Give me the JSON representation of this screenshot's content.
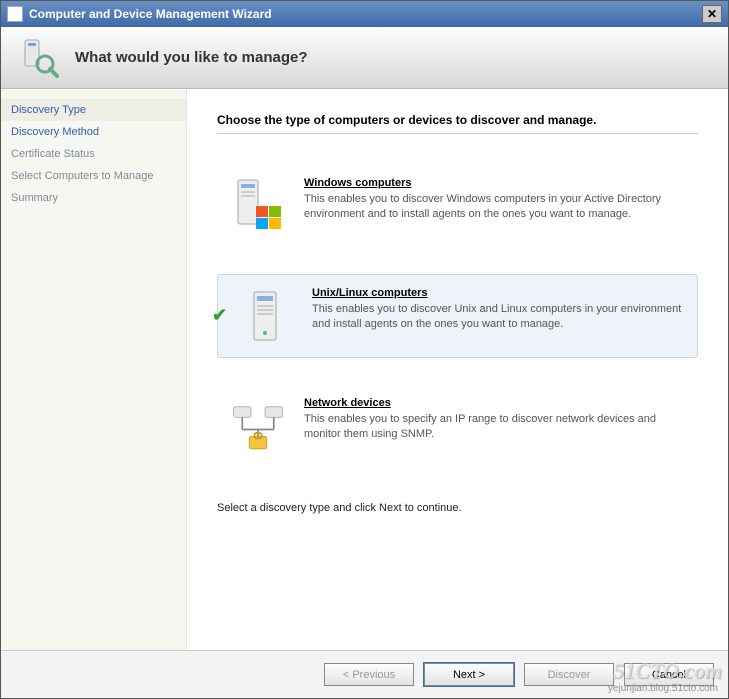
{
  "window": {
    "title": "Computer and Device Management Wizard"
  },
  "banner": {
    "heading": "What would you like to manage?"
  },
  "sidebar": {
    "items": [
      {
        "label": "Discovery Type",
        "current": true,
        "muted": false
      },
      {
        "label": "Discovery Method",
        "current": false,
        "muted": false
      },
      {
        "label": "Certificate Status",
        "current": false,
        "muted": true
      },
      {
        "label": "Select Computers to Manage",
        "current": false,
        "muted": true
      },
      {
        "label": "Summary",
        "current": false,
        "muted": true
      }
    ]
  },
  "main": {
    "instruction": "Choose the type of computers or devices to discover and manage.",
    "options": [
      {
        "icon": "windows-computers-icon",
        "title": "Windows computers",
        "desc": "This enables you to discover Windows computers in your Active Directory environment and to install agents on the ones you want to manage.",
        "selected": false
      },
      {
        "icon": "unix-linux-computers-icon",
        "title": "Unix/Linux computers",
        "desc": "This enables you to discover Unix and Linux computers in your environment and install agents on the ones you want to manage.",
        "selected": true
      },
      {
        "icon": "network-devices-icon",
        "title": "Network devices",
        "desc": "This enables you to specify an IP range to discover network devices and monitor them using SNMP.",
        "selected": false
      }
    ],
    "hint": "Select a discovery type and click Next to continue."
  },
  "footer": {
    "previous": "< Previous",
    "next": "Next >",
    "discover": "Discover",
    "cancel": "Cancel"
  },
  "watermark": {
    "main": "51CTO.com",
    "sub": "yejunjian.blog.51cto.com"
  }
}
